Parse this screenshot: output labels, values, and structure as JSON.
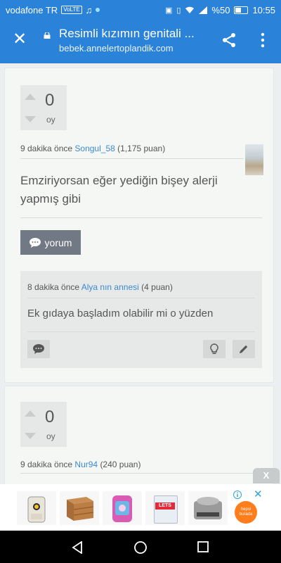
{
  "status": {
    "carrier": "vodafone TR",
    "volte": "VoLTE",
    "battery": "%50",
    "time": "10:55"
  },
  "browser": {
    "title": "Resimli kızımın genitali ...",
    "url": "bebek.annelertoplandik.com"
  },
  "post1": {
    "votes": "0",
    "votes_label": "oy",
    "time": "9 dakika önce",
    "user": "Songul_58",
    "points": "(1,175 puan)",
    "text": "Emziriyorsan eğer yediğin bişey alerji yapmış gibi",
    "comment_button": "yorum",
    "comment": {
      "time": "8 dakika önce",
      "user": "Alya nın annesi",
      "points": "(4 puan)",
      "text": "Ek gıdaya başladım olabilir mi o yüzden"
    }
  },
  "post2": {
    "votes": "0",
    "votes_label": "oy",
    "time": "9 dakika önce",
    "user": "Nur94",
    "points": "(240 puan)"
  },
  "ad": {
    "close_label": "X",
    "brand1": "LETS",
    "badge": "hepsi burada"
  },
  "colors": {
    "primary": "#2b82d9",
    "link": "#3b8ad2"
  }
}
